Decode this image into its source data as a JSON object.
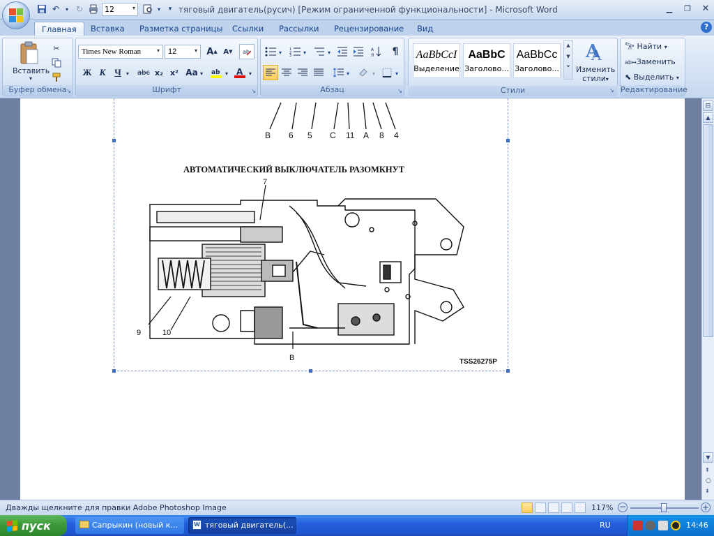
{
  "titlebar": {
    "font_size_value": "12",
    "title": "тяговый двигатель(русич) [Режим ограниченной функциональности] - Microsoft Word"
  },
  "tabs": [
    "Главная",
    "Вставка",
    "Разметка страницы",
    "Ссылки",
    "Рассылки",
    "Рецензирование",
    "Вид"
  ],
  "ribbon": {
    "clipboard": {
      "paste_label": "Вставить",
      "group_label": "Буфер обмена"
    },
    "font": {
      "font_name": "Times New Roman",
      "font_size": "12",
      "bold": "Ж",
      "italic": "К",
      "underline": "Ч",
      "strike": "abc",
      "subscript": "x₂",
      "superscript": "x²",
      "case": "Aa",
      "grow": "A",
      "shrink": "A",
      "group_label": "Шрифт"
    },
    "paragraph": {
      "group_label": "Абзац"
    },
    "styles": {
      "items": [
        {
          "sample": "AaBbCcI",
          "name": "Выделение"
        },
        {
          "sample": "AaBbC",
          "name": "Заголово..."
        },
        {
          "sample": "AaBbCc",
          "name": "Заголово..."
        }
      ],
      "change_styles_line1": "Изменить",
      "change_styles_line2": "стили",
      "group_label": "Стили"
    },
    "editing": {
      "find": "Найти",
      "replace": "Заменить",
      "select": "Выделить",
      "group_label": "Редактирование"
    }
  },
  "document": {
    "top_labels": [
      "B",
      "6",
      "5",
      "C",
      "11",
      "A",
      "8",
      "4"
    ],
    "diagram_title": "АВТОМАТИЧЕСКИЙ ВЫКЛЮЧАТЕЛЬ РАЗОМКНУТ",
    "callout_7": "7",
    "callout_9": "9",
    "callout_10": "10",
    "callout_b": "B",
    "figure_code": "TSS26275P"
  },
  "statusbar": {
    "text": "Дважды щелкните для правки Adobe Photoshop Image",
    "zoom": "117%"
  },
  "taskbar": {
    "start": "пуск",
    "tasks": [
      "Сапрыкин (новый к...",
      "тяговый двигатель(..."
    ],
    "lang": "RU",
    "clock": "14:46"
  },
  "colors": {
    "ribbon_bg": "#d4e2f4",
    "taskbar": "#245edb",
    "start": "#3c9a3a"
  }
}
